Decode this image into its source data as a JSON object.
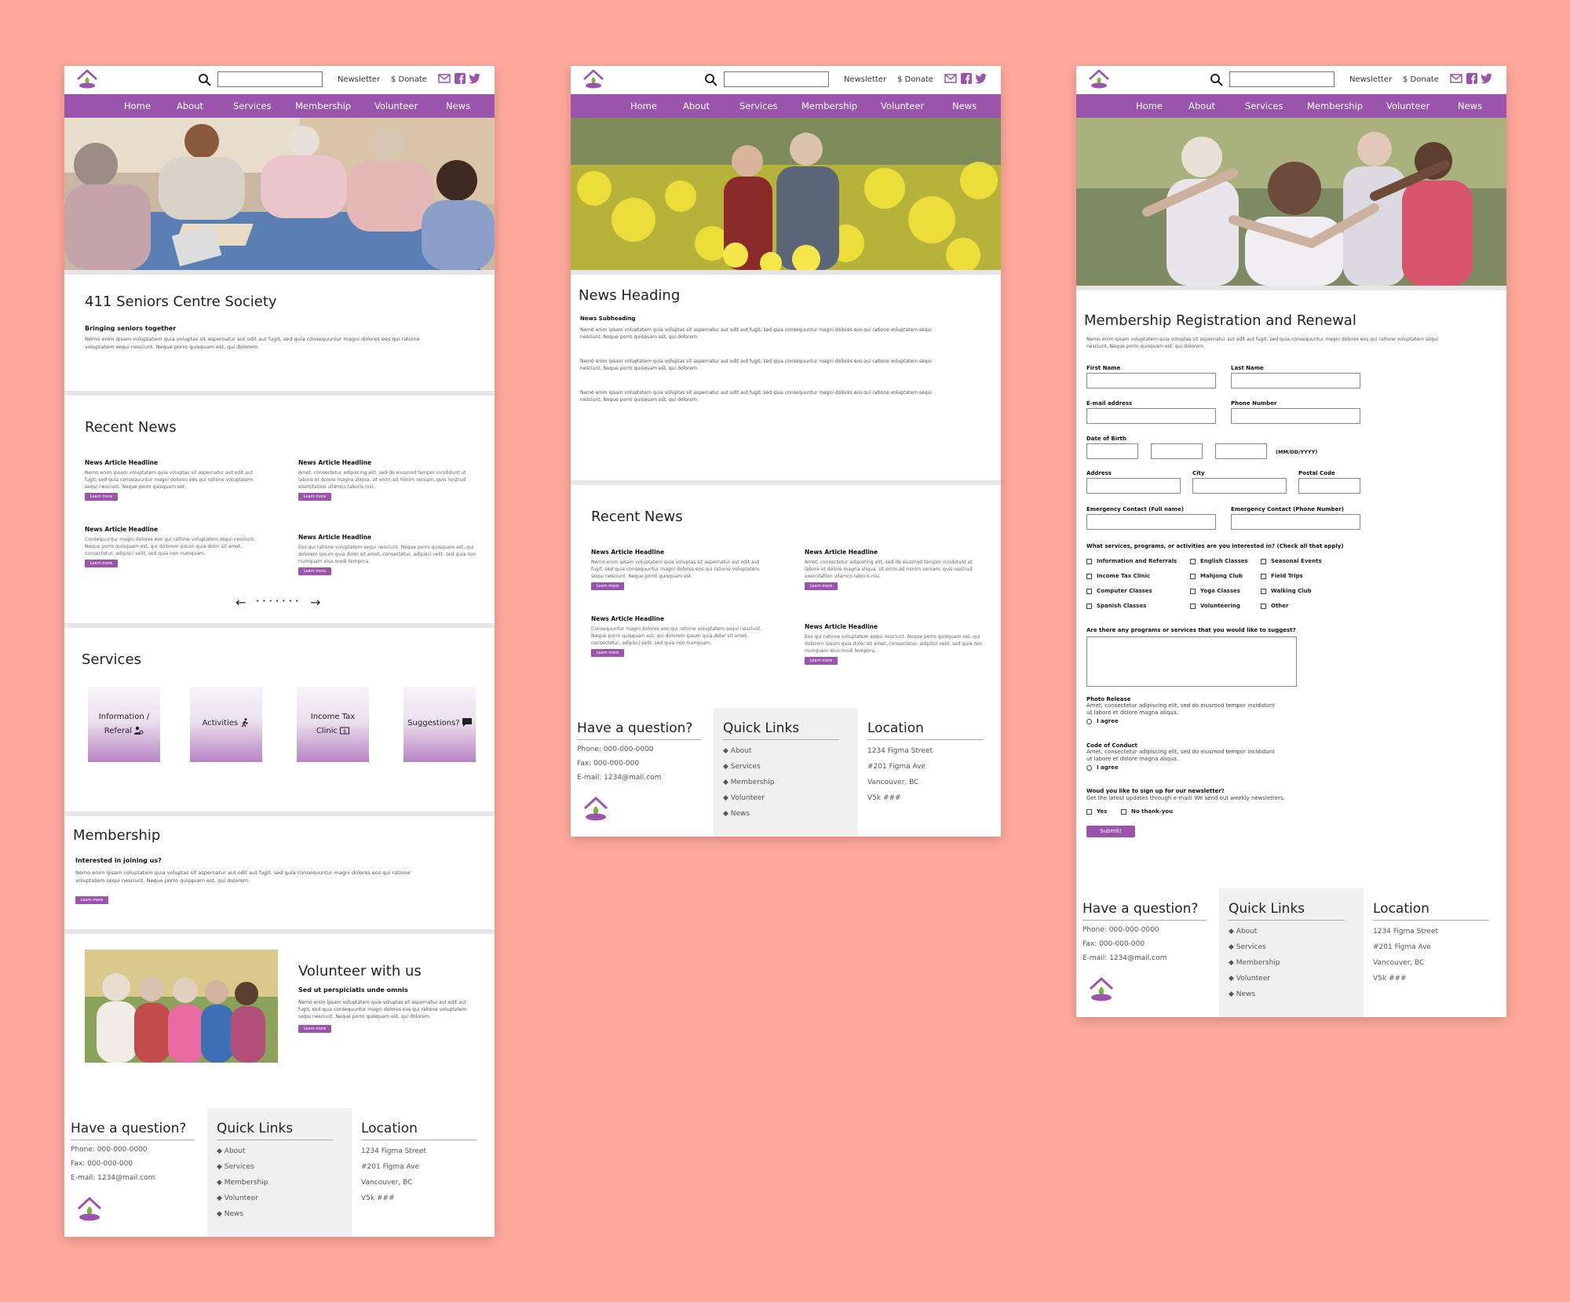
{
  "header": {
    "search_placeholder": "",
    "newsletter": "Newsletter",
    "donate": "$ Donate"
  },
  "nav": [
    "Home",
    "About",
    "Services",
    "Membership",
    "Volunteer",
    "News"
  ],
  "home": {
    "title": "411 Seniors Centre Society",
    "subtitle": "Bringing seniors together",
    "intro": "Nemo enim ipsam voluptatem quia voluptas sit aspernatur aut odit aut fugit, sed quia consequuntur magni dolores eos qui ratione voluptatem sequi nesciunt. Neque porro quisquam est, qui dolorem.",
    "recent_news_title": "Recent News",
    "news": [
      {
        "headline": "News Article Headline",
        "text": "Nemo enim ipsam voluptatem quia voluptas sit aspernatur aut odit aut fugit, sed quia consequuntur magni dolores eos qui ratione voluptatem sequi nesciunt. Neque porro quisquam est.",
        "button": "Learn more"
      },
      {
        "headline": "News Article Headline",
        "text": "Amet, consectetur adipiscing elit, sed do eiusmod tempor incididunt ut labore et dolore magna aliqua. Ut enim ad minim veniam, quis nostrud exercitation ullamco laboris nisi.",
        "button": "Learn more"
      },
      {
        "headline": "News Article Headline",
        "text": "Consequuntur magni dolores eos qui ratione voluptatem sequi nesciunt. Neque porro quisquam est, qui dolorem ipsum quia dolor sit amet, consectetur, adipisci velit, sed quia non numquam.",
        "button": "Learn more"
      },
      {
        "headline": "News Article Headline",
        "text": "Eos qui ratione voluptatem sequi nesciunt. Neque porro quisquam est, qui dolorem ipsum quia dolor sit amet, consectetur, adipisci velit, sed quia non numquam eius modi tempora.",
        "button": "Learn more"
      }
    ],
    "pager_prev": "←",
    "pager_dots": "• • • • • • •",
    "pager_next": "→",
    "services_title": "Services",
    "services": [
      {
        "line1": "Information /",
        "line2": "Referal"
      },
      {
        "line1": "Activities",
        "line2": ""
      },
      {
        "line1": "Income Tax",
        "line2": "Clinic"
      },
      {
        "line1": "Suggestions?",
        "line2": ""
      }
    ],
    "membership_title": "Membership",
    "membership_sub": "Interested in joining us?",
    "membership_text": "Nemo enim ipsam voluptatem quia voluptas sit aspernatur aut odit aut fugit, sed quia consequuntur magni dolores eos qui ratione voluptatem sequi nesciunt. Neque porro quisquam est, qui dolorem.",
    "membership_button": "Learn more",
    "volunteer_title": "Volunteer with us",
    "volunteer_sub": "Sed ut perspiciatis unde omnis",
    "volunteer_text": "Nemo enim ipsam voluptatem quia voluptas sit aspernatur aut odit aut fugit, sed quia consequuntur magni dolores eos qui ratione voluptatem sequi nesciunt. Neque porro quisquam est, qui dolorem.",
    "volunteer_button": "Learn more"
  },
  "news_page": {
    "heading": "News Heading",
    "subheading": "News Subheading",
    "paragraph": "Nemo enim ipsam voluptatem quia voluptas sit aspernatur aut odit aut fugit, sed quia consequuntur magni dolores eos qui ratione voluptatem sequi nesciunt. Neque porro quisquam est, qui dolorem.",
    "recent_news_title": "Recent News"
  },
  "member_page": {
    "title": "Membership Registration and Renewal",
    "intro": "Nemo enim ipsam voluptatem quia voluptas sit aspernatur aut odit aut fugit, sed quia consequuntur magni dolores eos qui ratione voluptatem sequi nesciunt. Neque porro quisquam est, qui dolorem.",
    "first_name": "First Name",
    "last_name": "Last Name",
    "email": "E-mail address",
    "phone": "Phone Number",
    "dob": "Date of Birth",
    "dob_format": "(MM/DD/YYYY)",
    "address": "Address",
    "city": "City",
    "postal": "Postal Code",
    "emerg_name": "Emergency Contact (Full name)",
    "emerg_phone": "Emergency Contact (Phone Number)",
    "interests_q": "What services, programs, or activities are you interested in? (Check all that apply)",
    "interests": [
      [
        "Information and Referrals",
        "English Classes",
        "Seasonal Events"
      ],
      [
        "Income Tax Clinic",
        "Mahjong Club",
        "Field Trips"
      ],
      [
        "Computer Classes",
        "Yoga Classes",
        "Walking Club"
      ],
      [
        "Spanish Classes",
        "Volunteering",
        "Other"
      ]
    ],
    "suggest_q": "Are there any programs or services that you would like to suggest?",
    "photo_title": "Photo Release",
    "photo_text": "Amet, consectetur adipiscing elit, sed do eiusmod tempor incididunt ut labore et dolore magna aliqua.",
    "agree": "I agree",
    "conduct_title": "Code of Conduct",
    "conduct_text": "Amet, consectetur adipiscing elit, sed do eiusmod tempor incididunt ut labore et dolore magna aliqua.",
    "newsletter_q": "Woud you like to sign up for our newsletter?",
    "newsletter_text": "Get the latest updates through e-mail! We send out weekly newsletters.",
    "yes": "Yes",
    "no": "No thank-you",
    "submit": "Submit!"
  },
  "footer": {
    "question_title": "Have a question?",
    "phone": "Phone: 000-000-0000",
    "fax": "Fax: 000-000-000",
    "email": "E-mail: 1234@mail.com",
    "quick_links_title": "Quick Links",
    "links": [
      "◆ About",
      "◆ Services",
      "◆ Membership",
      "◆ Volunteer",
      "◆ News"
    ],
    "location_title": "Location",
    "address": [
      "1234 Figma Street",
      "#201 Figma Ave",
      "Vancouver, BC",
      "V5k ###"
    ]
  },
  "colors": {
    "accent": "#9A54AC",
    "background": "#FFA89B"
  }
}
